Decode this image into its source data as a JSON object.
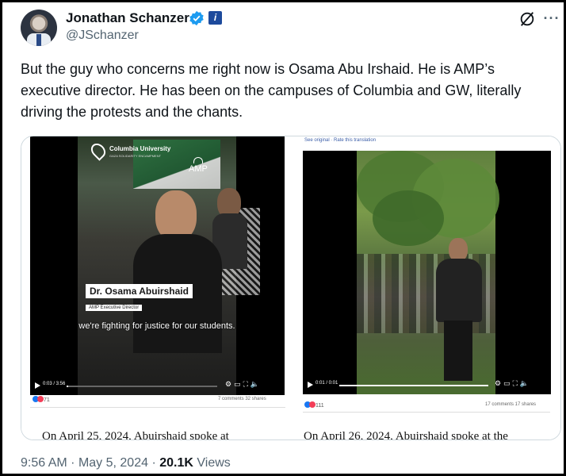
{
  "author": {
    "name": "Jonathan Schanzer",
    "handle": "@JSchanzer",
    "affiliate_badge": "i"
  },
  "tweet": {
    "text": "But the guy who concerns me right now is Osama Abu Irshaid. He is AMP’s executive director. He has been on the campuses of Columbia and GW, literally driving the protests and the chants."
  },
  "media": {
    "left": {
      "location_badge": "Columbia University",
      "location_sub": "GAZA SOLIDARITY ENCAMPMENT",
      "org_logo": "AMP",
      "lower_third_name": "Dr. Osama Abuirshaid",
      "lower_third_role": "AMP Executive Director",
      "subtitle": "we're fighting for justice for our students.",
      "time": "0:03 / 3:56",
      "progress": 0.01,
      "reactions": "71",
      "counts": "7 comments  32 shares",
      "cut_text": "On April 25, 2024, Abuirshaid spoke at"
    },
    "right": {
      "see_original": "See original · Rate this translation",
      "time": "0:01 / 0:01",
      "progress": 1.0,
      "reactions": "111",
      "counts": "17 comments  17 shares",
      "cut_text": "On April 26, 2024, Abuirshaid spoke at the"
    }
  },
  "footer": {
    "time": "9:56 AM",
    "date": "May 5, 2024",
    "views_count": "20.1K",
    "views_label": "Views"
  },
  "colors": {
    "verified": "#1d9bf0",
    "secondary_text": "#536471",
    "border": "#cfd9de"
  },
  "icons": [
    "verified-badge-icon",
    "grok-icon",
    "more-options-icon",
    "play-icon",
    "settings-icon",
    "fullscreen-icon",
    "volume-icon"
  ]
}
